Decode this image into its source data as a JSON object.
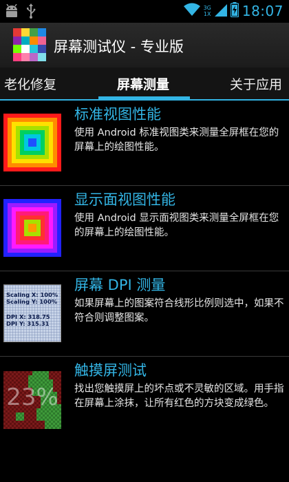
{
  "status_bar": {
    "time": "18:07",
    "network_top": "3G",
    "network_bottom": "1X"
  },
  "header": {
    "title": "屏幕测试仪 - 专业版"
  },
  "tabs": [
    {
      "label": "老化修复",
      "selected": false
    },
    {
      "label": "屏幕测量",
      "selected": true
    },
    {
      "label": "关于应用",
      "selected": false
    }
  ],
  "items": [
    {
      "title": "标准视图性能",
      "description": "使用 Android 标准视图类来测量全屏框在您的屏幕上的绘图性能。"
    },
    {
      "title": "显示面视图性能",
      "description": "使用 Android 显示面视图类来测量全屏框在您的屏幕上的绘图性能。"
    },
    {
      "title": "屏幕 DPI 测量",
      "description": "如果屏幕上的图案符合线形比例则选中，如果不符合则调整图案。",
      "thumb_lines": [
        "Scaling X: 100%",
        "Scaling Y: 100%",
        "DPI X: 318.75",
        "DPI Y: 315.31"
      ]
    },
    {
      "title": "触摸屏测试",
      "description": "找出您触摸屏上的坏点或不灵敏的区域。用手指在屏幕上涂抹，让所有红色的方块变成绿色。",
      "thumb_text": "23%"
    }
  ],
  "colors": {
    "accent": "#33b5e5",
    "background": "#000000",
    "touch_red": "#7a1a1a",
    "touch_green": "#3e9a3a"
  }
}
